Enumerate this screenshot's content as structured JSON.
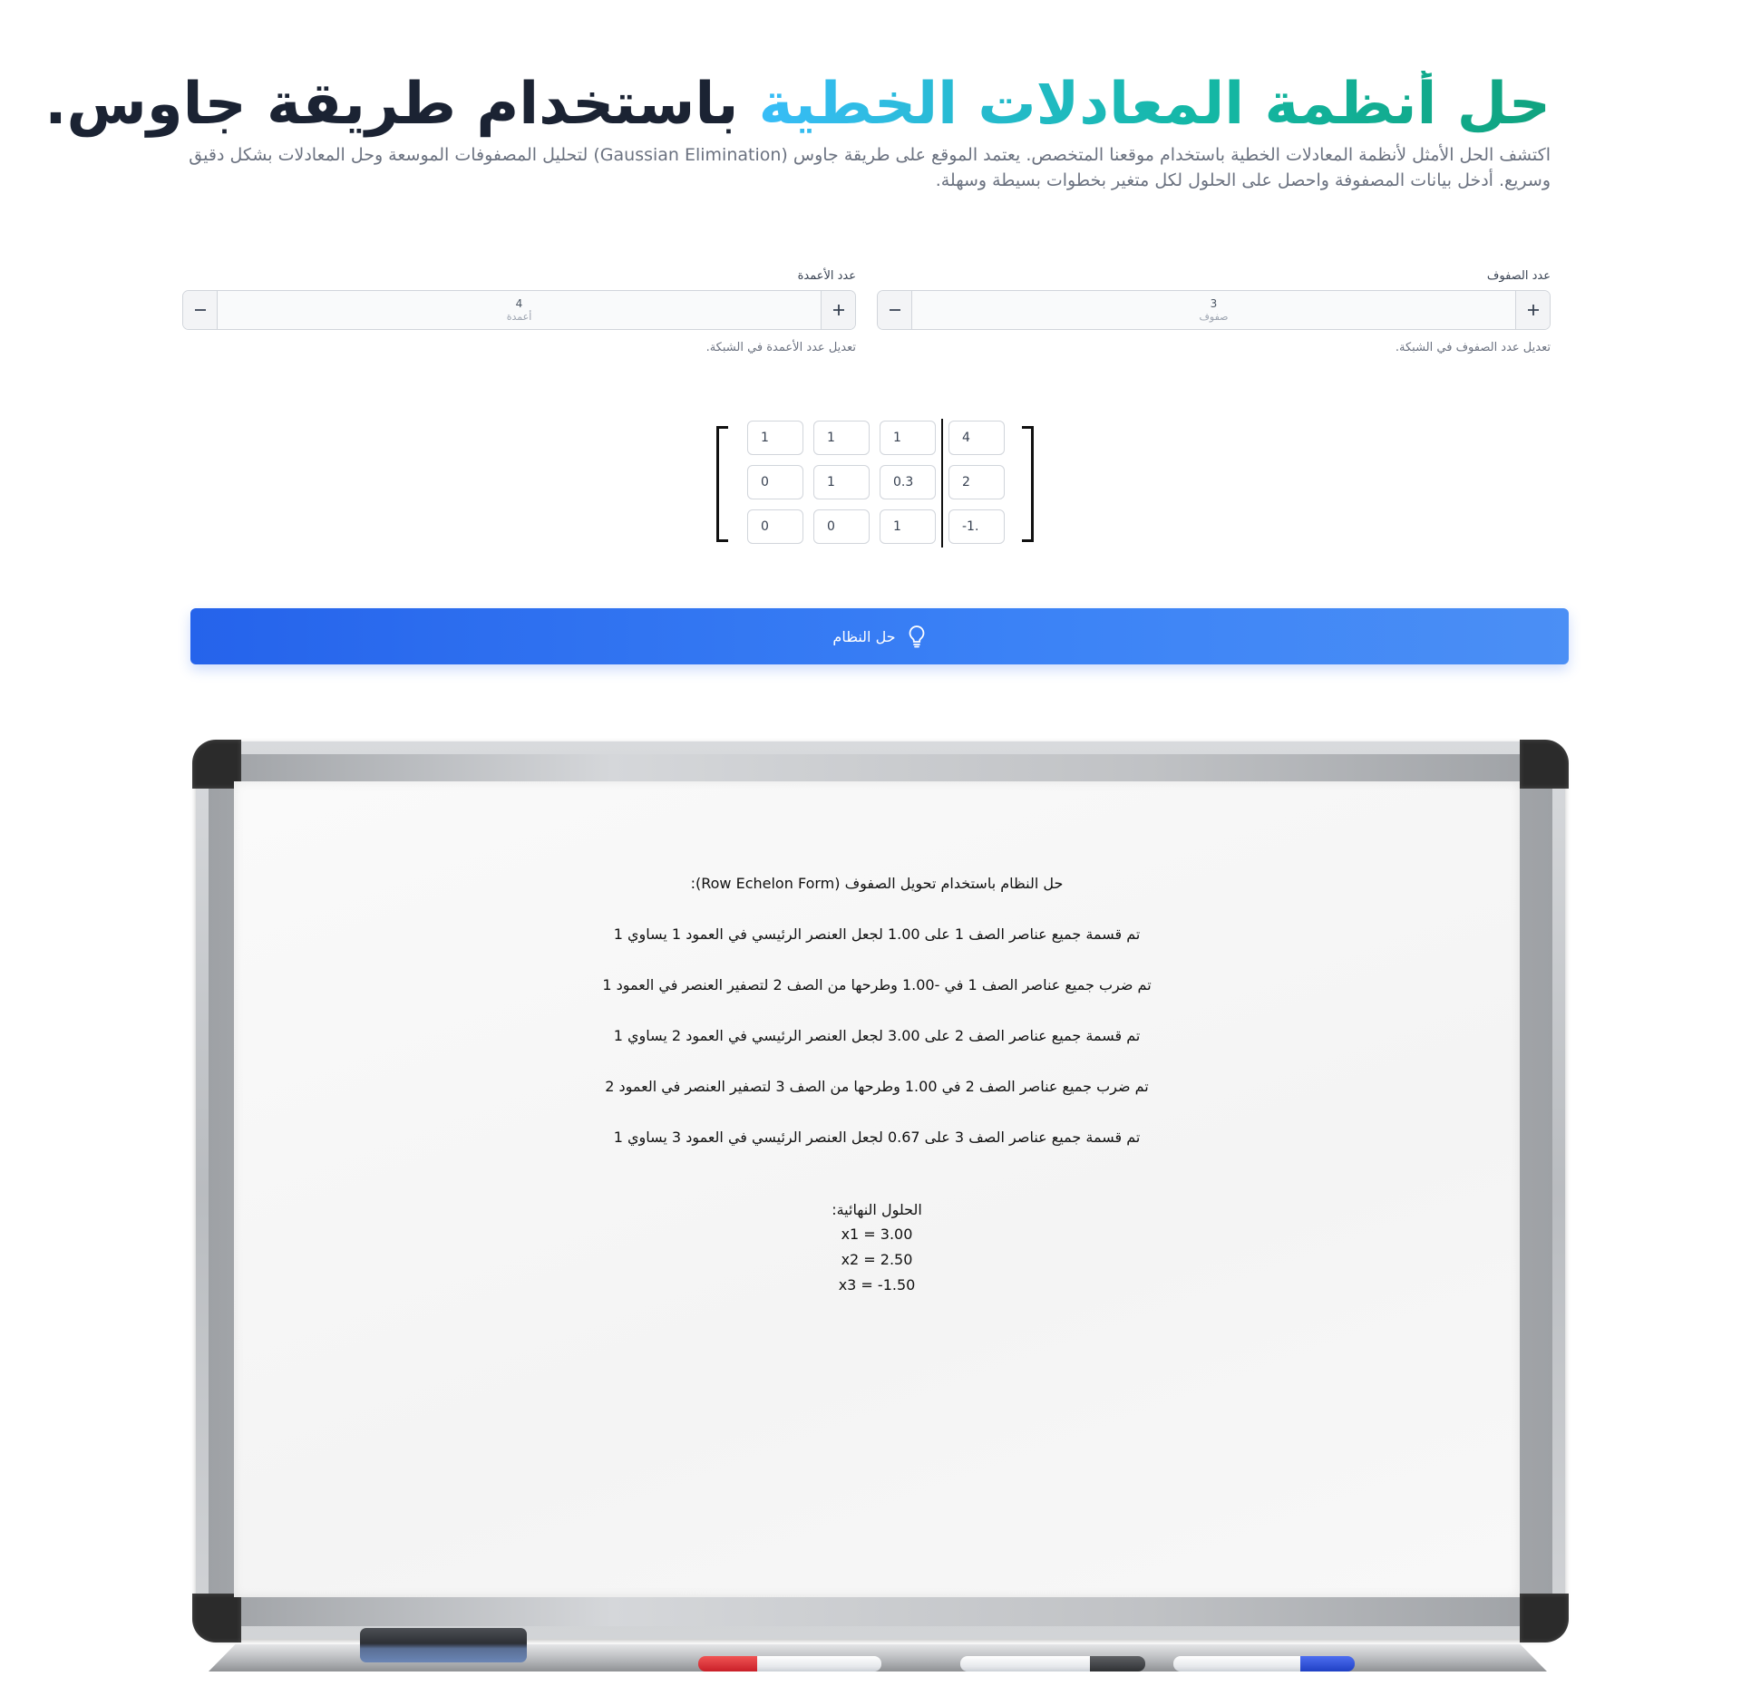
{
  "hero": {
    "title_highlight": "حل أنظمة المعادلات الخطية",
    "title_rest": " باستخدام طريقة جاوس.",
    "description": "اكتشف الحل الأمثل لأنظمة المعادلات الخطية باستخدام موقعنا المتخصص. يعتمد الموقع على طريقة جاوس (Gaussian Elimination) لتحليل المصفوفات الموسعة وحل المعادلات بشكل دقيق وسريع. أدخل بيانات المصفوفة واحصل على الحلول لكل متغير بخطوات بسيطة وسهلة.",
    "gradient_colors": [
      "#10a37f",
      "#38bdf8"
    ]
  },
  "rows_control": {
    "label": "عدد الصفوف",
    "value": "3",
    "unit": "صفوف",
    "help": "تعديل عدد الصفوف في الشبكة.",
    "plus_icon": "plus-icon",
    "minus_icon": "minus-icon"
  },
  "cols_control": {
    "label": "عدد الأعمدة",
    "value": "4",
    "unit": "أعمدة",
    "help": "تعديل عدد الأعمدة في الشبكة.",
    "plus_icon": "plus-icon",
    "minus_icon": "minus-icon"
  },
  "matrix": {
    "rows": [
      [
        "1",
        "1",
        "1",
        "4"
      ],
      [
        "0",
        "1",
        "0.3",
        "2"
      ],
      [
        "0",
        "0",
        "1",
        "-1.‎"
      ]
    ]
  },
  "solve_button": {
    "label": "حل النظام",
    "icon": "lightbulb-icon",
    "color": "#2563eb"
  },
  "whiteboard": {
    "heading": "حل النظام باستخدام تحويل الصفوف (Row Echelon Form):",
    "steps": [
      "تم قسمة جميع عناصر الصف 1 على 1.00 لجعل العنصر الرئيسي في العمود 1 يساوي 1",
      "تم ضرب جميع عناصر الصف 1 في -1.00 وطرحها من الصف 2 لتصفير العنصر في العمود 1",
      "تم قسمة جميع عناصر الصف 2 على 3.00 لجعل العنصر الرئيسي في العمود 2 يساوي 1",
      "تم ضرب جميع عناصر الصف 2 في 1.00 وطرحها من الصف 3 لتصفير العنصر في العمود 2",
      "تم قسمة جميع عناصر الصف 3 على 0.67 لجعل العنصر الرئيسي في العمود 3 يساوي 1"
    ],
    "final_title": "الحلول النهائية:",
    "solutions": [
      "x1 = 3.00",
      "x2 = 2.50",
      "x3 = -1.50"
    ]
  }
}
